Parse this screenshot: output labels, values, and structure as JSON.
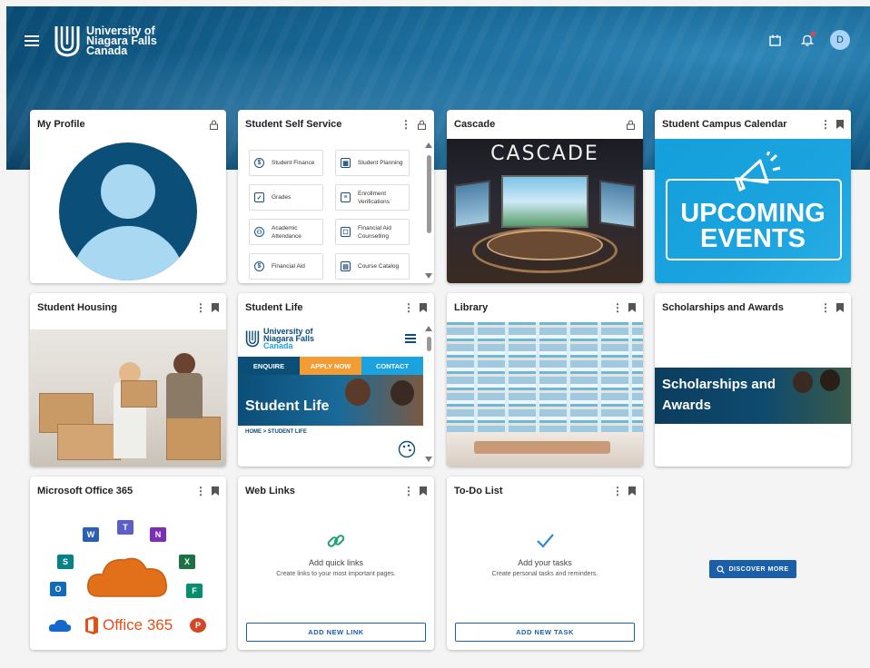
{
  "header": {
    "logo_line1": "University of",
    "logo_line2": "Niagara Falls",
    "logo_line3": "Canada",
    "avatar_initial": "D"
  },
  "cards": {
    "my_profile": {
      "title": "My Profile"
    },
    "self_service": {
      "title": "Student Self Service",
      "items": [
        {
          "label": "Student Finance",
          "icon": "dollar-icon"
        },
        {
          "label": "Student Planning",
          "icon": "calendar-icon"
        },
        {
          "label": "Grades",
          "icon": "grades-icon"
        },
        {
          "label": "Enrollment Verifications",
          "icon": "clipboard-icon"
        },
        {
          "label": "Academic Attendance",
          "icon": "people-icon"
        },
        {
          "label": "Financial Aid Counselling",
          "icon": "chat-icon"
        },
        {
          "label": "Financial Aid",
          "icon": "dollar-icon"
        },
        {
          "label": "Course Catalog",
          "icon": "book-icon"
        }
      ]
    },
    "cascade": {
      "title": "Cascade",
      "banner": "CASCADE"
    },
    "calendar": {
      "title": "Student Campus Calendar",
      "line1": "UPCOMING",
      "line2": "EVENTS"
    },
    "housing": {
      "title": "Student Housing"
    },
    "student_life": {
      "title": "Student Life",
      "logo_line1": "University of",
      "logo_line2": "Niagara Falls",
      "logo_line3": "Canada",
      "nav_enquire": "ENQUIRE",
      "nav_apply": "APPLY NOW",
      "nav_contact": "CONTACT",
      "hero_text": "Student Life",
      "breadcrumb": "HOME  >  STUDENT LIFE"
    },
    "library": {
      "title": "Library"
    },
    "scholarships": {
      "title": "Scholarships and Awards",
      "banner_line1": "Scholarships and",
      "banner_line2": "Awards"
    },
    "office": {
      "title": "Microsoft Office 365",
      "brand": "Office 365"
    },
    "web_links": {
      "title": "Web Links",
      "empty_title": "Add quick links",
      "empty_sub": "Create links to your most important pages.",
      "button": "ADD NEW LINK"
    },
    "todo": {
      "title": "To-Do List",
      "empty_title": "Add your tasks",
      "empty_sub": "Create personal tasks and reminders.",
      "button": "ADD NEW TASK"
    }
  },
  "discover_button": "DISCOVER MORE",
  "colors": {
    "primary": "#1a5fa8",
    "navy": "#0b4e78",
    "orange": "#f39c33",
    "sky": "#1aa3df"
  }
}
